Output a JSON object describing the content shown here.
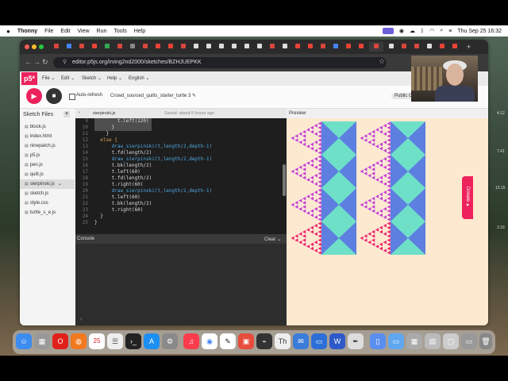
{
  "menubar": {
    "apple": "",
    "app": "Thonny",
    "items": [
      "File",
      "Edit",
      "View",
      "Run",
      "Tools",
      "Help"
    ],
    "datetime": "Thu Sep 25  16:32"
  },
  "browser": {
    "url": "editor.p5js.org/irving2nd2000/sketches/BZHJUEPKK"
  },
  "p5": {
    "logo": "p5*",
    "menu": [
      "File ⌄",
      "Edit ⌄",
      "Sketch ⌄",
      "Help ⌄",
      "English ⌄"
    ],
    "auto_refresh": "Auto-refresh",
    "sketch_name": "Crowd_sourced_quilts_starter_turtle 3 ✎",
    "user": "Public Gerald Reed"
  },
  "sidebar": {
    "title": "Sketch Files",
    "files": [
      "block.js",
      "index.html",
      "ninepatch.js",
      "p5.js",
      "pen.js",
      "quilt.js",
      "sierpinski.js",
      "sketch.js",
      "style.css",
      "turtle_s_e.js"
    ],
    "selected": "sierpinski.js"
  },
  "editor": {
    "tab_name": "sierpinski.js",
    "saved": "Saved: about 5 hours ago",
    "line_numbers": [
      "9",
      "10",
      "11",
      "12",
      "13",
      "14",
      "15",
      "16",
      "17",
      "18",
      "19",
      "20",
      "21",
      "22",
      "23",
      "24",
      "25"
    ],
    "lines": [
      "        t.left(120)",
      "      }",
      "    }",
      "  else {",
      "      draw_sierpinski(t,length/2,depth-1)",
      "      t.fd(length/2)",
      "      draw_sierpinski(t,length/2,depth-1)",
      "      t.bk(length/2)",
      "      t.left(60)",
      "      t.fd(length/2)",
      "      t.right(60)",
      "      draw_sierpinski(t,length/2,depth-1)",
      "      t.left(60)",
      "      t.bk(length/2)",
      "      t.right(60)",
      "  }",
      "}"
    ]
  },
  "console": {
    "title": "Console",
    "clear": "Clear ⌄",
    "prompt": "›"
  },
  "preview": {
    "title": "Preview",
    "background": "#fde8d0",
    "colors": {
      "magenta": "#c43fc4",
      "blue": "#5c7fe0",
      "teal": "#6fe0c8",
      "pink": "#ed225d"
    }
  },
  "donate": "Donate ♥",
  "side_numbers": [
    "4.12",
    "7.41",
    "13.15",
    "3.16"
  ]
}
